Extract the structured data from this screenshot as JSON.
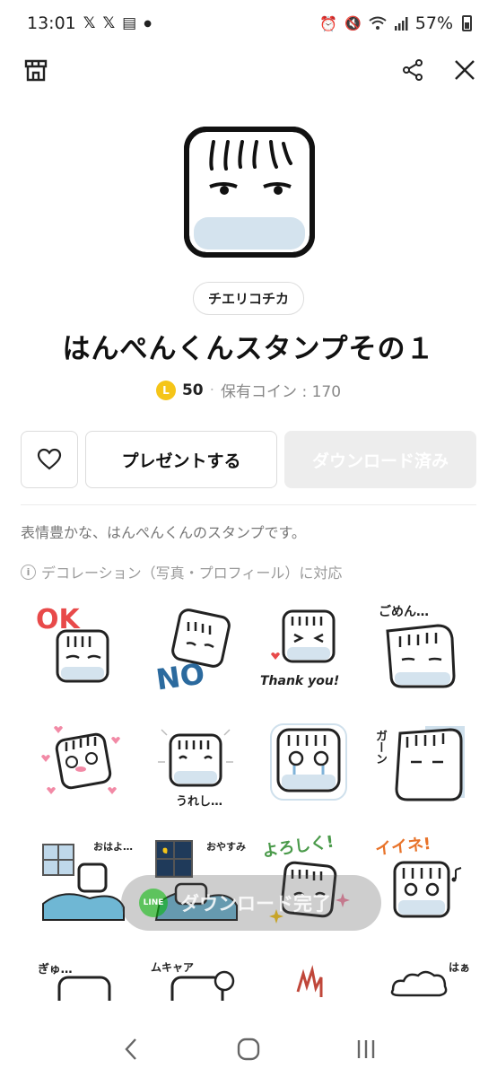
{
  "status": {
    "time": "13:01",
    "notif_icons": [
      "x-icon",
      "x-icon",
      "news-icon",
      "dot-icon"
    ],
    "battery": "57%"
  },
  "toolbar": {
    "store_icon": "store-icon",
    "share_icon": "share-icon",
    "close_icon": "close-icon"
  },
  "pack": {
    "author": "チエリコチカ",
    "title": "はんぺんくんスタンプその１",
    "coin_badge": "L",
    "price": "50",
    "owned_coins": "保有コイン : 170",
    "description": "表情豊かな、はんぺんくんのスタンプです。",
    "deco_note": "デコレーション（写真・プロフィール）に対応"
  },
  "actions": {
    "present_label": "プレゼントする",
    "download_label": "ダウンロード済み"
  },
  "stickers": [
    {
      "name": "sticker-ok",
      "text": "OK"
    },
    {
      "name": "sticker-no",
      "text": "NO"
    },
    {
      "name": "sticker-thank-you",
      "text": "Thank you!"
    },
    {
      "name": "sticker-gomen",
      "text": "ごめん…"
    },
    {
      "name": "sticker-hearts",
      "text": ""
    },
    {
      "name": "sticker-ureshi",
      "text": "うれし…"
    },
    {
      "name": "sticker-crying",
      "text": ""
    },
    {
      "name": "sticker-ga-n",
      "text": "ガーン"
    },
    {
      "name": "sticker-ohayo",
      "text": "おはよ…"
    },
    {
      "name": "sticker-oyasumi",
      "text": "おやすみ"
    },
    {
      "name": "sticker-yoroshiku",
      "text": "よろしく!"
    },
    {
      "name": "sticker-iine",
      "text": "イイネ!"
    },
    {
      "name": "sticker-gyu",
      "text": "ぎゅ…"
    },
    {
      "name": "sticker-mukya",
      "text": "ムキャア"
    },
    {
      "name": "sticker-fire",
      "text": ""
    },
    {
      "name": "sticker-haa",
      "text": "はぁ"
    }
  ],
  "share": {
    "line_badge": "LINE",
    "label": "ダウンロード完了"
  },
  "colors": {
    "accent_coin": "#f5c518",
    "ok_red": "#e84a4a",
    "no_blue": "#2b6a9e",
    "heart_pink": "#f28aa6"
  }
}
